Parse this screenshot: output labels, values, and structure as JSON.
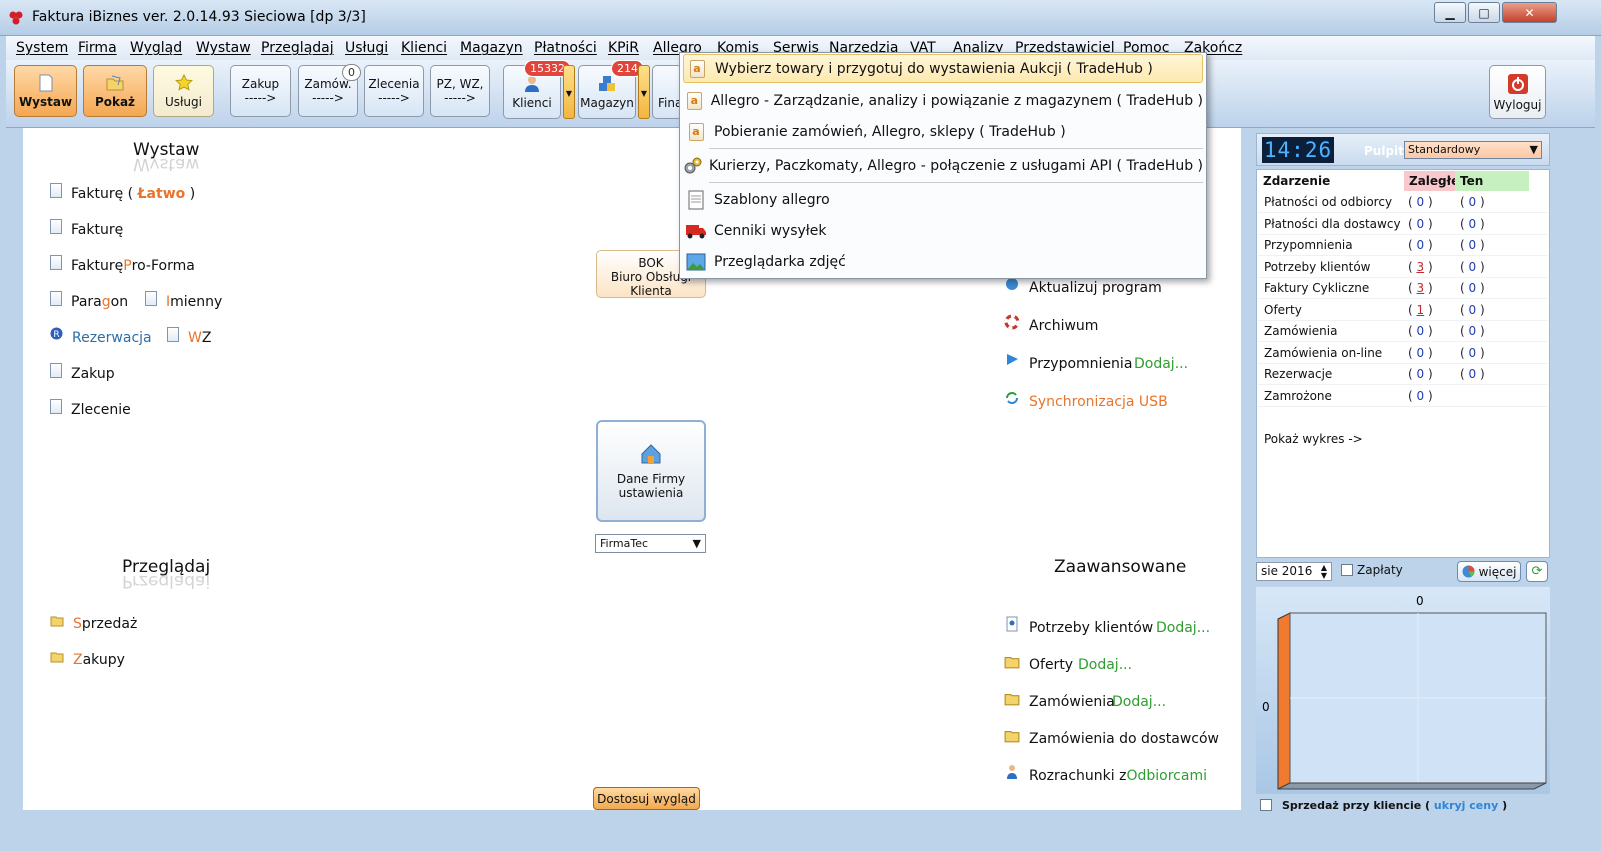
{
  "window": {
    "title": "Faktura iBiznes ver. 2.0.14.93  Sieciowa  [dp 3/3]",
    "min": "▁",
    "max": "□",
    "close": "✕"
  },
  "menubar": [
    "System",
    "Firma",
    "Wygląd",
    "Wystaw",
    "Przeglądaj",
    "Usługi",
    "Klienci",
    "Magazyn",
    "Płatności",
    "KPiR",
    "Allegro",
    "Komis",
    "Serwis",
    "Narzedzia",
    "VAT",
    "Analizy",
    "Przedstawiciel",
    "Pomoc",
    "Zakończ"
  ],
  "toolbar": {
    "wystaw": "Wystaw",
    "pokaz": "Pokaż",
    "uslugi": "Usługi",
    "zakup_l1": "Zakup",
    "zakup_l2": "----->",
    "zamow_l1": "Zamów.",
    "zamow_l2": "----->",
    "zamow_badge": "0",
    "zlecenia_l1": "Zlecenia",
    "zlecenia_l2": "----->",
    "pzwz_l1": "PZ, WZ,",
    "pzwz_l2": "----->",
    "klienci": "Klienci",
    "klienci_badge": "15332",
    "magazyn": "Magazyn",
    "magazyn_badge": "214",
    "fina": "Fina",
    "wyloguj": "Wyloguj",
    "dropdown_arrow": "▼"
  },
  "wystaw_section": {
    "title": "Wystaw",
    "faktura_easy": "Fakturę (",
    "latwo": "Łatwo",
    "close_paren": ")",
    "faktura": "Fakturę",
    "proforma_a": "Fakturę ",
    "proforma_b": "P",
    "proforma_c": "ro-Forma",
    "paragon_a": "Para",
    "paragon_b": "g",
    "paragon_c": "on",
    "imienny_a": "I",
    "imienny_b": "mienny",
    "rezerwacja": "Rezerwacja",
    "wz_a": "W",
    "wz_b": "Z",
    "zakup": "Zakup",
    "zlecenie": "Zlecenie"
  },
  "przegladaj_section": {
    "title": "Przeglądaj",
    "sprzedaz_a": "S",
    "sprzedaz_b": "przedaż",
    "zakupy_a": "Z",
    "zakupy_b": "akupy"
  },
  "center": {
    "bok_l1": "BOK",
    "bok_l2": "Biuro Obsługi",
    "bok_l3": "Klienta",
    "dane_l1": "Dane Firmy",
    "dane_l2": "ustawienia",
    "firm_select": "FirmaTec",
    "dostosuj": "Dostosuj wygląd"
  },
  "right_links": {
    "aktualizuj": "Aktualizuj program",
    "archiwum": "Archiwum",
    "przypomnienia": "Przypomnienia",
    "dodaj": "Dodaj...",
    "synchronizacja": "Synchronizacja USB"
  },
  "zaawansowane": {
    "title": "Zaawansowane",
    "potrzeby": "Potrzeby klientów",
    "oferty": "Oferty",
    "zamowienia": "Zamówienia",
    "dodaj": "Dodaj...",
    "zam_dostawcow": "Zamówienia do dostawców",
    "rozrachunki_a": "Rozrachunki z ",
    "rozrachunki_b": "Odbiorcami"
  },
  "dashboard": {
    "clock": "14:26",
    "pulpit_label": "Pulpit",
    "pulpit_value": "Standardowy",
    "headers": {
      "zdarzenie": "Zdarzenie",
      "zalegle": "Zaległe",
      "ten": "Ten"
    },
    "rows": [
      {
        "name": "Płatności od odbiorcy",
        "zalegle": "0",
        "ten": "0"
      },
      {
        "name": "Płatności dla dostawcy",
        "zalegle": "0",
        "ten": "0"
      },
      {
        "name": "Przypomnienia",
        "zalegle": "0",
        "ten": "0"
      },
      {
        "name": "Potrzeby klientów",
        "zalegle": "3",
        "ten": "0"
      },
      {
        "name": "Faktury Cykliczne",
        "zalegle": "3",
        "ten": "0"
      },
      {
        "name": "Oferty",
        "zalegle": "1",
        "ten": "0"
      },
      {
        "name": "Zamówienia",
        "zalegle": "0",
        "ten": "0"
      },
      {
        "name": "Zamówienia on-line",
        "zalegle": "0",
        "ten": "0"
      },
      {
        "name": "Rezerwacje",
        "zalegle": "0",
        "ten": "0"
      },
      {
        "name": "Zamrożone",
        "zalegle": "0",
        "ten": ""
      }
    ],
    "pokaz_wykres": "Pokaż wykres ->",
    "month": "sie  2016",
    "zaplaty": "Zapłaty",
    "wiecej": "więcej",
    "chart_top_label": "0",
    "chart_left_label": "0",
    "sprzedaz_label": "Sprzedaż przy kliencie (",
    "ukryj_ceny": "ukryj ceny",
    "close_paren": ")"
  },
  "allegro_menu": {
    "items": [
      {
        "label": "Wybierz towary i przygotuj do wystawienia Aukcji ( TradeHub )",
        "icon": "allegro-icon"
      },
      {
        "label": "Allegro - Zarządzanie, analizy i powiązanie z magazynem  ( TradeHub )",
        "icon": "allegro-icon"
      },
      {
        "label": "Pobieranie zamówień, Allegro, sklepy ( TradeHub )",
        "icon": "allegro-icon"
      },
      {
        "label": "Kurierzy, Paczkomaty, Allegro - połączenie z usługami API ( TradeHub )",
        "icon": "gears-icon"
      },
      {
        "label": "Szablony allegro",
        "icon": "document-icon"
      },
      {
        "label": "Cenniki wysyłek",
        "icon": "truck-icon"
      },
      {
        "label": "Przeglądarka zdjęć",
        "icon": "image-icon"
      }
    ]
  },
  "colors": {
    "accent_orange": "#e7752b",
    "link_green": "#2f9e2f",
    "toolbar_blue": "#bdd2ea"
  }
}
